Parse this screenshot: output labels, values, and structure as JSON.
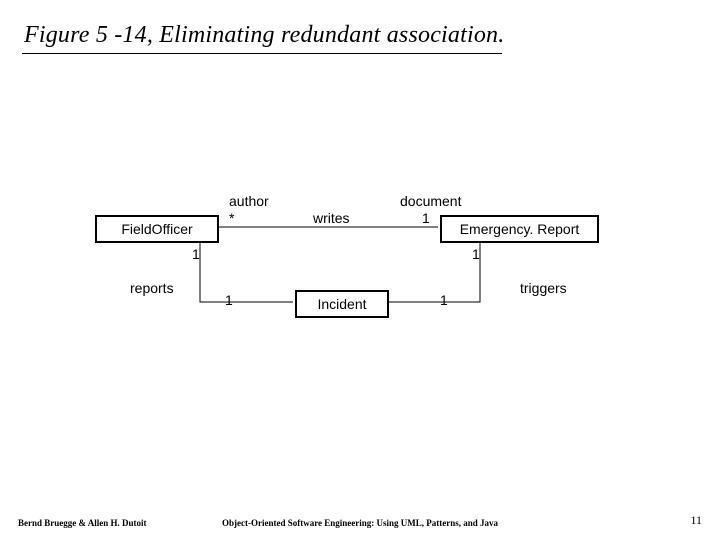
{
  "title": "Figure 5 -14, Eliminating redundant association.",
  "classes": {
    "fieldOfficer": "FieldOfficer",
    "emergencyReport": "Emergency. Report",
    "incident": "Incident"
  },
  "assoc": {
    "writes": {
      "name": "writes",
      "leftRole": "author",
      "leftMult": "*",
      "rightRole": "document",
      "rightMult": "1"
    },
    "reports": {
      "name": "reports",
      "leftMult": "1",
      "rightMult": "1"
    },
    "triggers": {
      "name": "triggers",
      "leftMult": "1",
      "rightMult": "1"
    }
  },
  "footer": {
    "left": "Bernd Bruegge & Allen H. Dutoit",
    "center": "Object-Oriented Software Engineering: Using UML, Patterns, and Java",
    "pageNum": "11"
  }
}
